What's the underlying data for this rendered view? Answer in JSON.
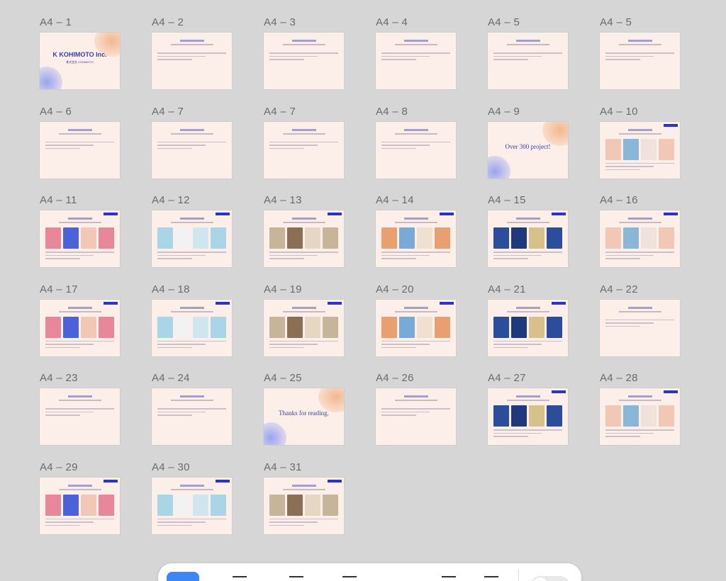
{
  "pages": [
    {
      "label": "A4 – 1",
      "kind": "cover",
      "title": "K KOHIMOTO Inc.",
      "subtitle": "株式会社 KOHIMOTO"
    },
    {
      "label": "A4 – 2",
      "kind": "text",
      "title": "Corporate philosophy"
    },
    {
      "label": "A4 – 3",
      "kind": "text",
      "title": "Corporate"
    },
    {
      "label": "A4 – 4",
      "kind": "text",
      "title": "Flow"
    },
    {
      "label": "A4 – 5",
      "kind": "text",
      "title": "Process"
    },
    {
      "label": "A4 – 5",
      "kind": "text",
      "title": "Research"
    },
    {
      "label": "A4 – 6",
      "kind": "text",
      "title": "Design"
    },
    {
      "label": "A4 – 7",
      "kind": "text",
      "title": "Coding"
    },
    {
      "label": "A4 – 7",
      "kind": "text",
      "title": "Option"
    },
    {
      "label": "A4 – 8",
      "kind": "text",
      "title": "Maintenance"
    },
    {
      "label": "A4 – 9",
      "kind": "big",
      "title": "Over 300 project!"
    },
    {
      "label": "A4 – 10",
      "kind": "work",
      "title": "ECC BLOG"
    },
    {
      "label": "A4 – 11",
      "kind": "work",
      "title": "ZINN ONLINE CLINIC"
    },
    {
      "label": "A4 – 12",
      "kind": "work",
      "title": "Aessi"
    },
    {
      "label": "A4 – 13",
      "kind": "work",
      "title": "Yoog ini"
    },
    {
      "label": "A4 – 14",
      "kind": "work",
      "title": "HOKUNY"
    },
    {
      "label": "A4 – 15",
      "kind": "work",
      "title": "Schick Japan"
    },
    {
      "label": "A4 – 16",
      "kind": "work",
      "title": "C Channel influencer"
    },
    {
      "label": "A4 – 17",
      "kind": "work",
      "title": "ALGIS"
    },
    {
      "label": "A4 – 18",
      "kind": "work",
      "title": "maruiyu"
    },
    {
      "label": "A4 – 19",
      "kind": "work",
      "title": "Hakko"
    },
    {
      "label": "A4 – 20",
      "kind": "work",
      "title": "Arteria Miyan"
    },
    {
      "label": "A4 – 21",
      "kind": "work",
      "title": "Marugame Kaihou"
    },
    {
      "label": "A4 – 22",
      "kind": "text",
      "title": "Clients"
    },
    {
      "label": "A4 – 23",
      "kind": "text",
      "title": "Web Trends Lab."
    },
    {
      "label": "A4 – 24",
      "kind": "text",
      "title": "Member"
    },
    {
      "label": "A4 – 25",
      "kind": "big",
      "title": "Thanks for reading."
    },
    {
      "label": "A4 – 26",
      "kind": "text",
      "title": "Maintenance"
    },
    {
      "label": "A4 – 27",
      "kind": "work",
      "title": "Yuttoro"
    },
    {
      "label": "A4 – 28",
      "kind": "work",
      "title": "PROQUALITE"
    },
    {
      "label": "A4 – 29",
      "kind": "work",
      "title": "ASF"
    },
    {
      "label": "A4 – 30",
      "kind": "work",
      "title": "Enzo's Tree"
    },
    {
      "label": "A4 – 31",
      "kind": "work",
      "title": "BIJOUX"
    }
  ],
  "colors": {
    "background": "#d6d6d6",
    "slide": "#fcefe9",
    "accent": "#2b33c9",
    "label": "#6b6b6b"
  },
  "toolbar": {
    "tools": [
      "select-tool",
      "hand-tool",
      "frame-tool",
      "pen-tool",
      "comment-tool",
      "more-tool"
    ],
    "active": "select-tool"
  }
}
